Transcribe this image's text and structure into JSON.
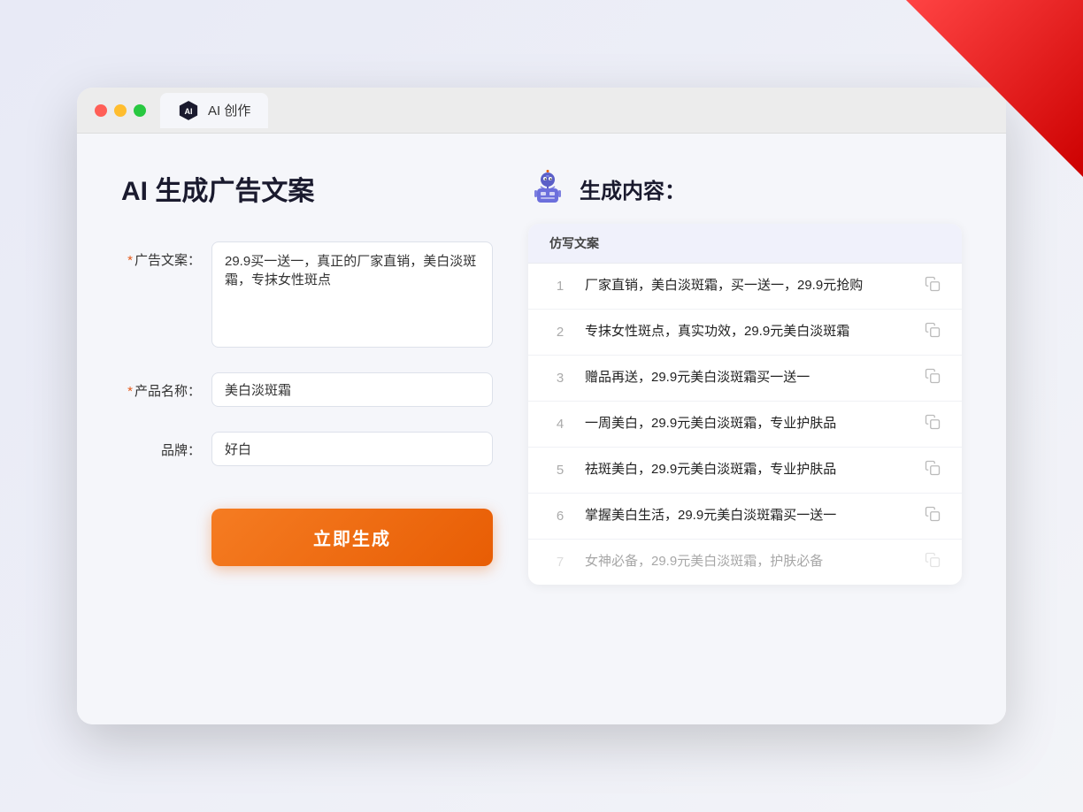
{
  "decoration": {
    "corner_color": "#cc0000"
  },
  "browser": {
    "tab_title": "AI 创作"
  },
  "page": {
    "title": "AI 生成广告文案",
    "form": {
      "ad_copy_label": "广告文案：",
      "ad_copy_required": "*",
      "ad_copy_value": "29.9买一送一，真正的厂家直销，美白淡斑霜，专抹女性斑点",
      "product_name_label": "产品名称：",
      "product_name_required": "*",
      "product_name_value": "美白淡斑霜",
      "brand_label": "品牌：",
      "brand_value": "好白",
      "generate_btn": "立即生成"
    },
    "results": {
      "header_icon": "robot",
      "header_title": "生成内容：",
      "column_header": "仿写文案",
      "items": [
        {
          "num": "1",
          "text": "厂家直销，美白淡斑霜，买一送一，29.9元抢购",
          "faded": false
        },
        {
          "num": "2",
          "text": "专抹女性斑点，真实功效，29.9元美白淡斑霜",
          "faded": false
        },
        {
          "num": "3",
          "text": "赠品再送，29.9元美白淡斑霜买一送一",
          "faded": false
        },
        {
          "num": "4",
          "text": "一周美白，29.9元美白淡斑霜，专业护肤品",
          "faded": false
        },
        {
          "num": "5",
          "text": "祛斑美白，29.9元美白淡斑霜，专业护肤品",
          "faded": false
        },
        {
          "num": "6",
          "text": "掌握美白生活，29.9元美白淡斑霜买一送一",
          "faded": false
        },
        {
          "num": "7",
          "text": "女神必备，29.9元美白淡斑霜，护肤必备",
          "faded": true
        }
      ]
    }
  }
}
